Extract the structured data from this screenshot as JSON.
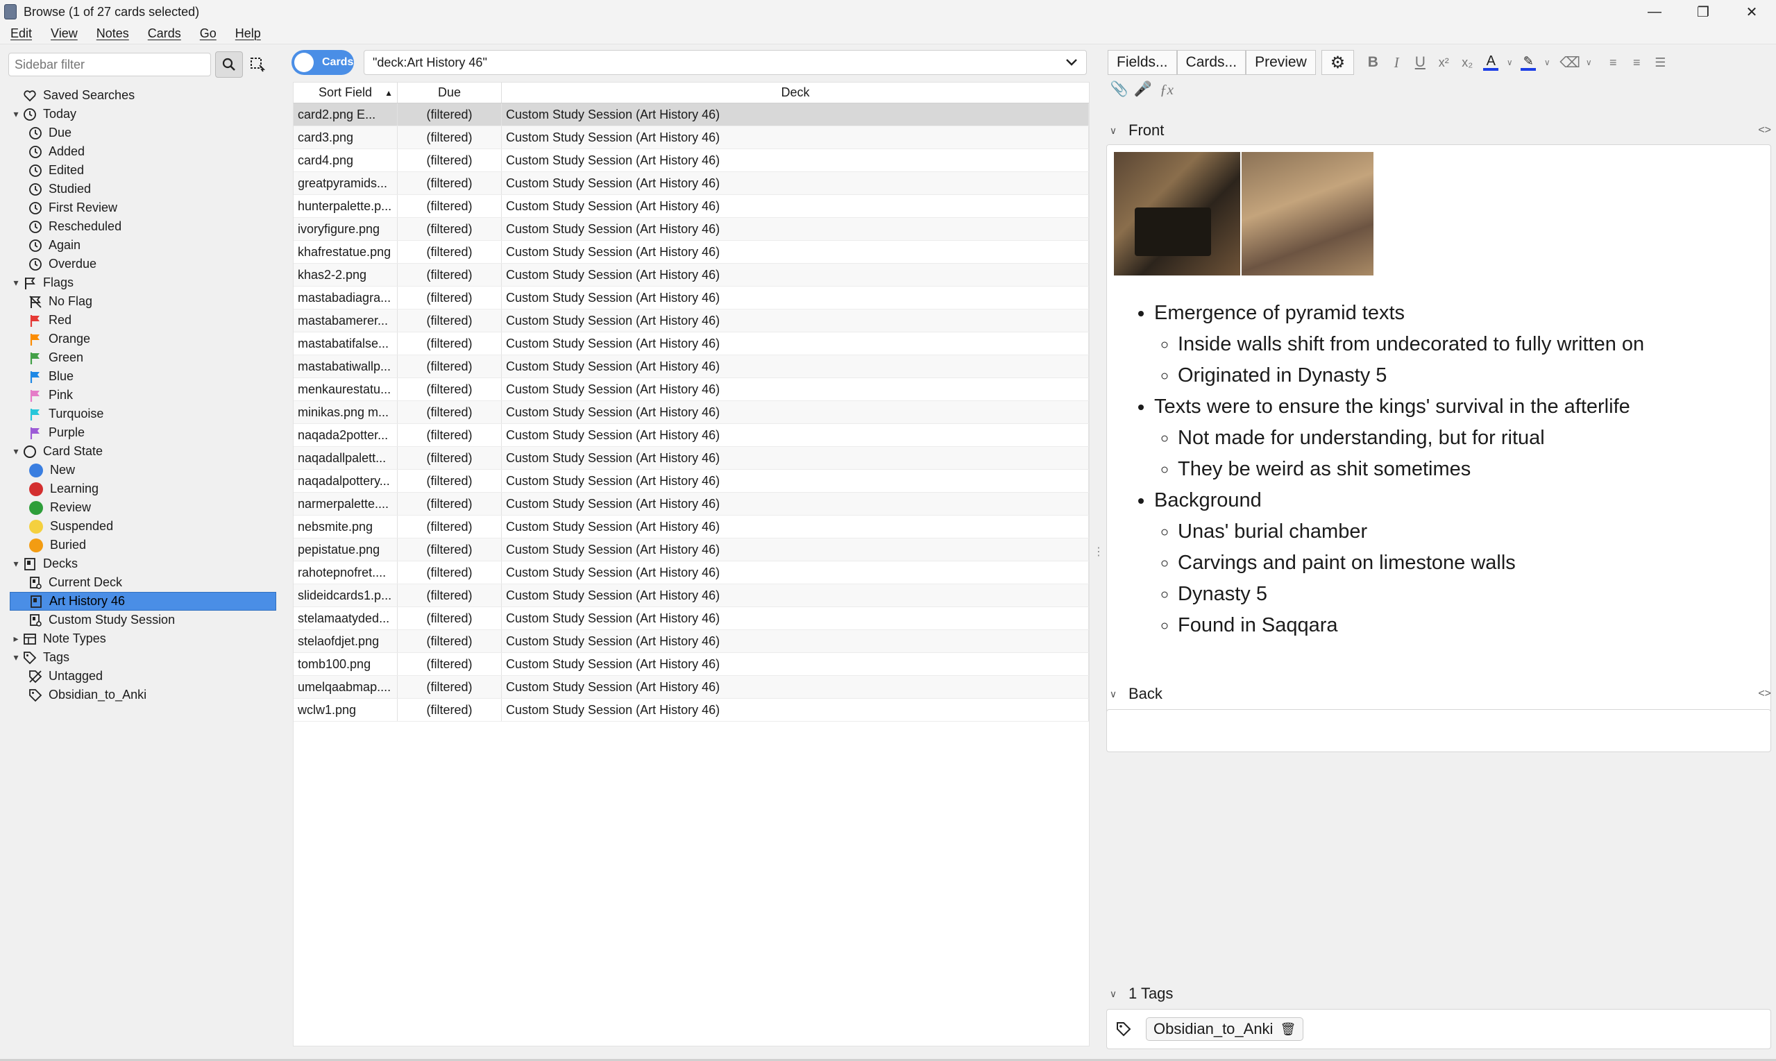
{
  "window": {
    "title": "Browse (1 of 27 cards selected)"
  },
  "menu": [
    "Edit",
    "View",
    "Notes",
    "Cards",
    "Go",
    "Help"
  ],
  "sidebar": {
    "filter_placeholder": "Sidebar filter",
    "items": [
      {
        "label": "Saved Searches",
        "icon": "heart-icon",
        "level": 0,
        "arrow": ""
      },
      {
        "label": "Today",
        "icon": "clock-icon",
        "level": 0,
        "arrow": "▾"
      },
      {
        "label": "Due",
        "icon": "clock-icon",
        "level": 1
      },
      {
        "label": "Added",
        "icon": "clock-icon",
        "level": 1
      },
      {
        "label": "Edited",
        "icon": "clock-icon",
        "level": 1
      },
      {
        "label": "Studied",
        "icon": "clock-icon",
        "level": 1
      },
      {
        "label": "First Review",
        "icon": "clock-icon",
        "level": 1
      },
      {
        "label": "Rescheduled",
        "icon": "clock-icon",
        "level": 1
      },
      {
        "label": "Again",
        "icon": "clock-icon",
        "level": 1
      },
      {
        "label": "Overdue",
        "icon": "clock-icon",
        "level": 1
      },
      {
        "label": "Flags",
        "icon": "flag-outline-icon",
        "level": 0,
        "arrow": "▾"
      },
      {
        "label": "No Flag",
        "icon": "no-flag-icon",
        "level": 1
      },
      {
        "label": "Red",
        "icon": "flag-icon",
        "color": "#e53935",
        "level": 1
      },
      {
        "label": "Orange",
        "icon": "flag-icon",
        "color": "#fb8c00",
        "level": 1
      },
      {
        "label": "Green",
        "icon": "flag-icon",
        "color": "#43a047",
        "level": 1
      },
      {
        "label": "Blue",
        "icon": "flag-icon",
        "color": "#1e88e5",
        "level": 1
      },
      {
        "label": "Pink",
        "icon": "flag-icon",
        "color": "#e57cc8",
        "level": 1
      },
      {
        "label": "Turquoise",
        "icon": "flag-icon",
        "color": "#26c6da",
        "level": 1
      },
      {
        "label": "Purple",
        "icon": "flag-icon",
        "color": "#9c5bd6",
        "level": 1
      },
      {
        "label": "Card State",
        "icon": "circle-outline-icon",
        "level": 0,
        "arrow": "▾"
      },
      {
        "label": "New",
        "icon": "dot-icon",
        "color": "#3a7ee0",
        "level": 1
      },
      {
        "label": "Learning",
        "icon": "dot-icon",
        "color": "#d32f2f",
        "level": 1
      },
      {
        "label": "Review",
        "icon": "dot-icon",
        "color": "#2e9e3a",
        "level": 1
      },
      {
        "label": "Suspended",
        "icon": "dot-icon",
        "color": "#f4d03f",
        "level": 1
      },
      {
        "label": "Buried",
        "icon": "dot-icon",
        "color": "#f39c12",
        "level": 1
      },
      {
        "label": "Decks",
        "icon": "deck-icon",
        "level": 0,
        "arrow": "▾"
      },
      {
        "label": "Current Deck",
        "icon": "deck-search-icon",
        "level": 1
      },
      {
        "label": "Art History 46",
        "icon": "deck-icon",
        "level": 1,
        "selected": true
      },
      {
        "label": "Custom Study Session",
        "icon": "deck-search-icon",
        "level": 1
      },
      {
        "label": "Note Types",
        "icon": "note-type-icon",
        "level": 0,
        "arrow": "▸"
      },
      {
        "label": "Tags",
        "icon": "tag-icon",
        "level": 0,
        "arrow": "▾"
      },
      {
        "label": "Untagged",
        "icon": "untagged-icon",
        "level": 1
      },
      {
        "label": "Obsidian_to_Anki",
        "icon": "tag-icon",
        "level": 1
      }
    ]
  },
  "browser": {
    "toggle_label": "Cards",
    "search_value": "\"deck:Art History 46\"",
    "columns": [
      "Sort Field",
      "Due",
      "Deck"
    ],
    "rows": [
      {
        "sort": "card2.png   E...",
        "due": "(filtered)",
        "deck": "Custom Study Session (Art History 46)",
        "selected": true
      },
      {
        "sort": "card3.png",
        "due": "(filtered)",
        "deck": "Custom Study Session (Art History 46)"
      },
      {
        "sort": "card4.png",
        "due": "(filtered)",
        "deck": "Custom Study Session (Art History 46)"
      },
      {
        "sort": "greatpyramids...",
        "due": "(filtered)",
        "deck": "Custom Study Session (Art History 46)"
      },
      {
        "sort": "hunterpalette.p...",
        "due": "(filtered)",
        "deck": "Custom Study Session (Art History 46)"
      },
      {
        "sort": "ivoryfigure.png",
        "due": "(filtered)",
        "deck": "Custom Study Session (Art History 46)"
      },
      {
        "sort": "khafrestatue.png",
        "due": "(filtered)",
        "deck": "Custom Study Session (Art History 46)"
      },
      {
        "sort": "khas2-2.png",
        "due": "(filtered)",
        "deck": "Custom Study Session (Art History 46)"
      },
      {
        "sort": "mastabadiagra...",
        "due": "(filtered)",
        "deck": "Custom Study Session (Art History 46)"
      },
      {
        "sort": "mastabamerer...",
        "due": "(filtered)",
        "deck": "Custom Study Session (Art History 46)"
      },
      {
        "sort": "mastabatifalse...",
        "due": "(filtered)",
        "deck": "Custom Study Session (Art History 46)"
      },
      {
        "sort": "mastabatiwallp...",
        "due": "(filtered)",
        "deck": "Custom Study Session (Art History 46)"
      },
      {
        "sort": "menkaurestatu...",
        "due": "(filtered)",
        "deck": "Custom Study Session (Art History 46)"
      },
      {
        "sort": "minikas.png  m...",
        "due": "(filtered)",
        "deck": "Custom Study Session (Art History 46)"
      },
      {
        "sort": "naqada2potter...",
        "due": "(filtered)",
        "deck": "Custom Study Session (Art History 46)"
      },
      {
        "sort": "naqadallpalett...",
        "due": "(filtered)",
        "deck": "Custom Study Session (Art History 46)"
      },
      {
        "sort": "naqadalpottery...",
        "due": "(filtered)",
        "deck": "Custom Study Session (Art History 46)"
      },
      {
        "sort": "narmerpalette....",
        "due": "(filtered)",
        "deck": "Custom Study Session (Art History 46)"
      },
      {
        "sort": "nebsmite.png",
        "due": "(filtered)",
        "deck": "Custom Study Session (Art History 46)"
      },
      {
        "sort": "pepistatue.png",
        "due": "(filtered)",
        "deck": "Custom Study Session (Art History 46)"
      },
      {
        "sort": "rahotepnofret....",
        "due": "(filtered)",
        "deck": "Custom Study Session (Art History 46)"
      },
      {
        "sort": "slideidcards1.p...",
        "due": "(filtered)",
        "deck": "Custom Study Session (Art History 46)"
      },
      {
        "sort": "stelamaatyded...",
        "due": "(filtered)",
        "deck": "Custom Study Session (Art History 46)"
      },
      {
        "sort": "stelaofdjet.png",
        "due": "(filtered)",
        "deck": "Custom Study Session (Art History 46)"
      },
      {
        "sort": "tomb100.png",
        "due": "(filtered)",
        "deck": "Custom Study Session (Art History 46)"
      },
      {
        "sort": "umelqaabmap....",
        "due": "(filtered)",
        "deck": "Custom Study Session (Art History 46)"
      },
      {
        "sort": "wclw1.png",
        "due": "(filtered)",
        "deck": "Custom Study Session (Art History 46)"
      }
    ]
  },
  "editor": {
    "buttons": [
      "Fields...",
      "Cards...",
      "Preview"
    ],
    "front_label": "Front",
    "back_label": "Back",
    "front_image_alt": "pyramid burial chamber",
    "notes": [
      {
        "text": "Emergence of pyramid texts",
        "sub": [
          "Inside walls shift from undecorated to fully written on",
          "Originated in Dynasty 5"
        ]
      },
      {
        "text": "Texts were to ensure the kings' survival in the afterlife",
        "sub": [
          "Not made for understanding, but for ritual",
          "They be weird as shit sometimes"
        ]
      },
      {
        "text": "Background",
        "sub": [
          "Unas' burial chamber",
          "Carvings and paint on limestone walls",
          "Dynasty 5",
          "Found in Saqqara"
        ]
      }
    ],
    "tags_label": "1 Tags",
    "tags": [
      "Obsidian_to_Anki"
    ]
  }
}
